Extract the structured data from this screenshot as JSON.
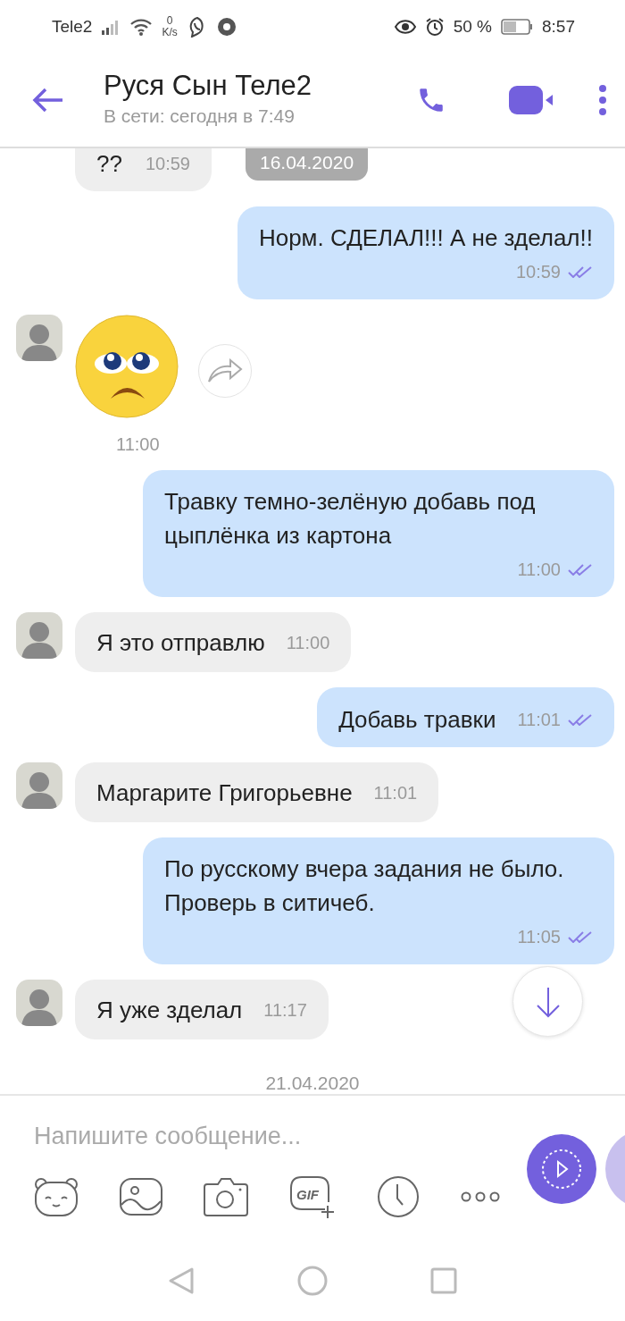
{
  "status_bar": {
    "carrier": "Tele2",
    "speed_value": "0",
    "speed_unit": "K/s",
    "battery": "50 %",
    "time": "8:57"
  },
  "header": {
    "title": "Руся Сын Теле2",
    "subtitle": "В сети: сегодня в 7:49"
  },
  "messages": [
    {
      "kind": "partial",
      "text": "??",
      "time": "10:59",
      "date": "16.04.2020"
    },
    {
      "kind": "outgoing",
      "text": "Норм. СДЕЛАЛ!!! А не зделал!!",
      "time": "10:59",
      "read": true
    },
    {
      "kind": "sticker",
      "time": "11:00"
    },
    {
      "kind": "outgoing",
      "text": "Травку темно-зелёную добавь под цыплёнка из картона",
      "time": "11:00",
      "read": true
    },
    {
      "kind": "incoming",
      "text": "Я это отправлю",
      "time": "11:00"
    },
    {
      "kind": "outgoing_inline",
      "text": "Добавь травки",
      "time": "11:01",
      "read": true
    },
    {
      "kind": "incoming",
      "text": "Маргарите Григорьевне",
      "time": "11:01"
    },
    {
      "kind": "outgoing",
      "text": "По русскому вчера задания не было. Проверь в ситичеб.",
      "time": "11:05",
      "read": true
    },
    {
      "kind": "incoming",
      "text": "Я уже зделал",
      "time": "11:17"
    },
    {
      "kind": "date",
      "text": "21.04.2020"
    }
  ],
  "composer": {
    "placeholder": "Напишите сообщение...",
    "gif_label": "GIF"
  }
}
